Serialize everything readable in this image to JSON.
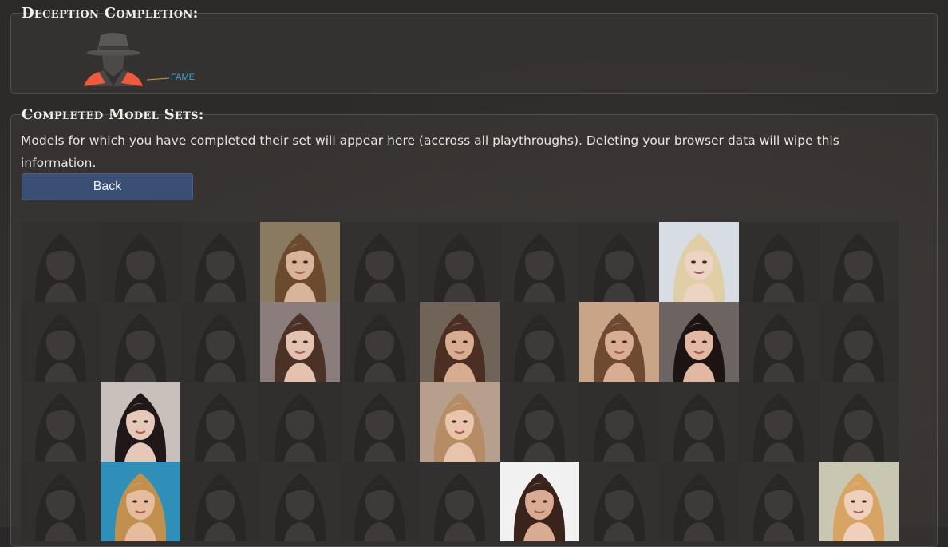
{
  "deception": {
    "heading": "Deception Completion:",
    "fame_label": "FAME"
  },
  "models": {
    "heading": "Completed Model Sets:",
    "description": "Models for which you have completed their set will appear here (accross all playthroughs). Deleting your browser data will wipe this information.",
    "back_label": "Back"
  },
  "grid": {
    "columns": 11,
    "rows": 4,
    "completed": [
      {
        "row": 0,
        "col": 3,
        "bg": "#8a7a62",
        "hair": "#6b4a2e",
        "skin": "#d9b39a"
      },
      {
        "row": 0,
        "col": 8,
        "bg": "#d7dde3",
        "hair": "#e0cfa6",
        "skin": "#edd3c2"
      },
      {
        "row": 1,
        "col": 3,
        "bg": "#8a7d7b",
        "hair": "#4a3226",
        "skin": "#e4c2b0"
      },
      {
        "row": 1,
        "col": 5,
        "bg": "#6f6457",
        "hair": "#4b2f22",
        "skin": "#d8ac8f"
      },
      {
        "row": 1,
        "col": 7,
        "bg": "#caa487",
        "hair": "#6e4a33",
        "skin": "#d9ad92"
      },
      {
        "row": 1,
        "col": 8,
        "bg": "#6b6461",
        "hair": "#1c1413",
        "skin": "#e2b8a3"
      },
      {
        "row": 2,
        "col": 1,
        "bg": "#c9c0bb",
        "hair": "#1f1718",
        "skin": "#e6c8b8"
      },
      {
        "row": 2,
        "col": 5,
        "bg": "#b79f8d",
        "hair": "#b58c63",
        "skin": "#e9c4ad"
      },
      {
        "row": 3,
        "col": 1,
        "bg": "#2f8fb9",
        "hair": "#c1904f",
        "skin": "#e6bc9f"
      },
      {
        "row": 3,
        "col": 6,
        "bg": "#f1f1f1",
        "hair": "#3a231a",
        "skin": "#d9ab93"
      },
      {
        "row": 3,
        "col": 10,
        "bg": "#c9c7b2",
        "hair": "#d7a464",
        "skin": "#eed0bd"
      }
    ]
  }
}
